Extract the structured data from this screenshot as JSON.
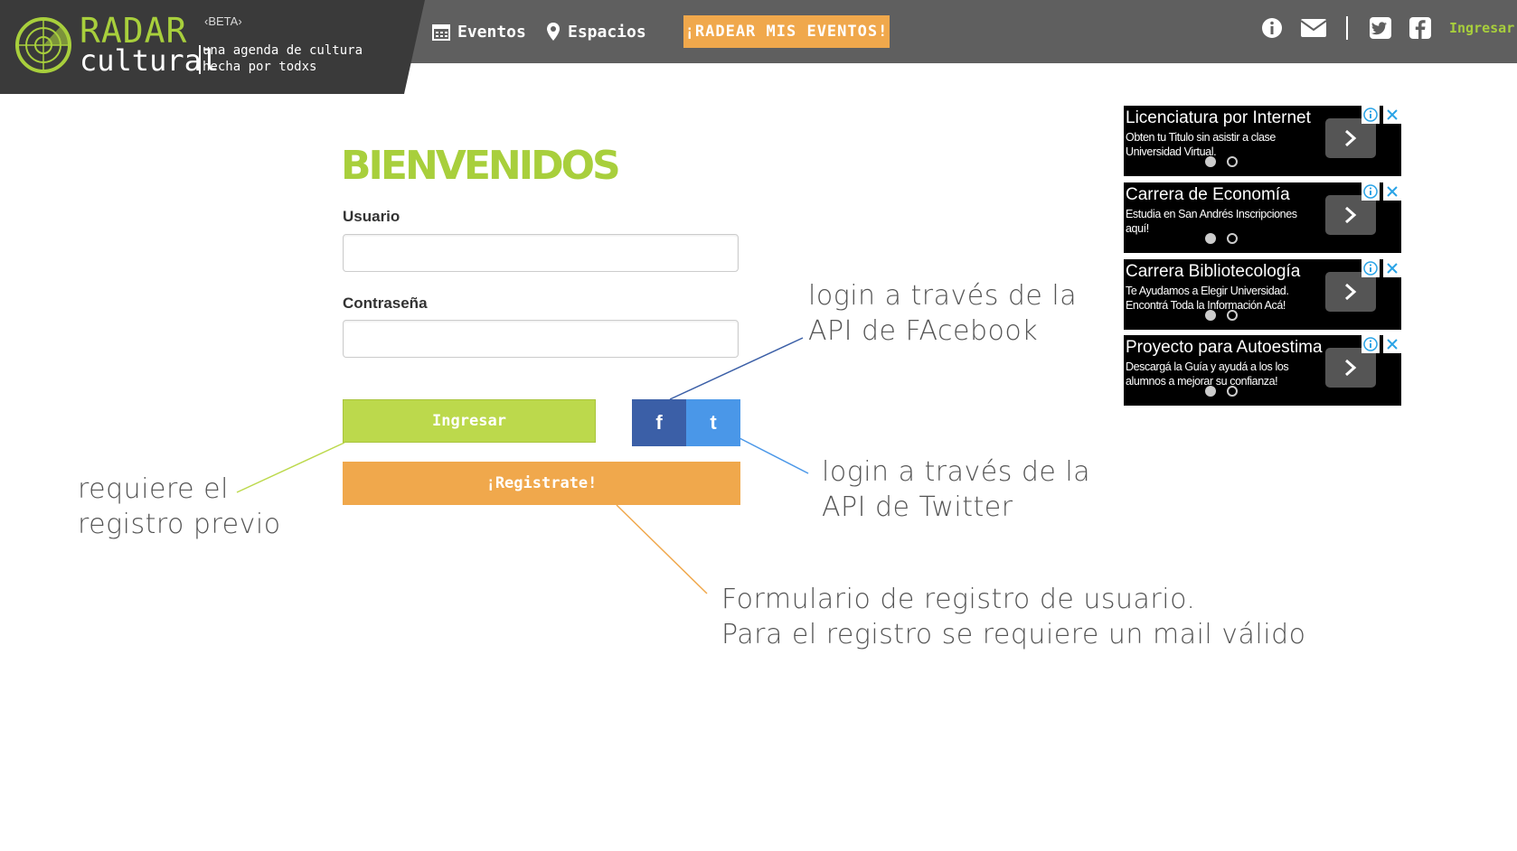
{
  "header": {
    "brand_top": "RADAR",
    "brand_bottom": "cultural",
    "beta": "‹BETA›",
    "tagline_line1": "una agenda de cultura",
    "tagline_line2": "hecha por todxs",
    "nav": [
      {
        "label": "Eventos",
        "icon": "calendar-icon"
      },
      {
        "label": "Espacios",
        "icon": "map-pin-icon"
      }
    ],
    "cta": "¡RADEAR MIS EVENTOS!",
    "icons": [
      "info-icon",
      "mail-icon",
      "twitter-icon",
      "facebook-icon"
    ],
    "login_link": "Ingresar"
  },
  "login": {
    "title": "BIENVENIDOS",
    "user_label": "Usuario",
    "user_value": "",
    "password_label": "Contraseña",
    "password_value": "",
    "submit_label": "Ingresar",
    "facebook_label": "f",
    "twitter_label": "t",
    "register_label": "¡Registrate!"
  },
  "annotations": {
    "facebook": [
      "login a través de la",
      "API de FAcebook"
    ],
    "twitter": [
      "login a través de la",
      "API de Twitter"
    ],
    "previo": [
      "requiere el",
      "registro previo"
    ],
    "form": [
      "Formulario de registro de usuario.",
      "Para el registro se requiere un mail válido"
    ]
  },
  "ads": [
    {
      "title": "Licenciatura por Internet",
      "desc": "Obten tu Titulo sin asistir a clase Universidad Virtual."
    },
    {
      "title": "Carrera de Economía",
      "desc": "Estudia en San Andrés Inscripciones aquí!"
    },
    {
      "title": "Carrera Bibliotecología",
      "desc": "Te Ayudamos a Elegir Universidad. Encontrá Toda la Información Acá!"
    },
    {
      "title": "Proyecto para Autoestima",
      "desc": "Descargá la Guía y ayudá a los los alumnos a mejorar su confianza!"
    }
  ],
  "colors": {
    "brand_green": "#a8cf3c",
    "orange": "#f0a84c",
    "header_gray": "#5f5f5f",
    "facebook_blue": "#3b5fa7",
    "twitter_blue": "#4a97e8"
  }
}
